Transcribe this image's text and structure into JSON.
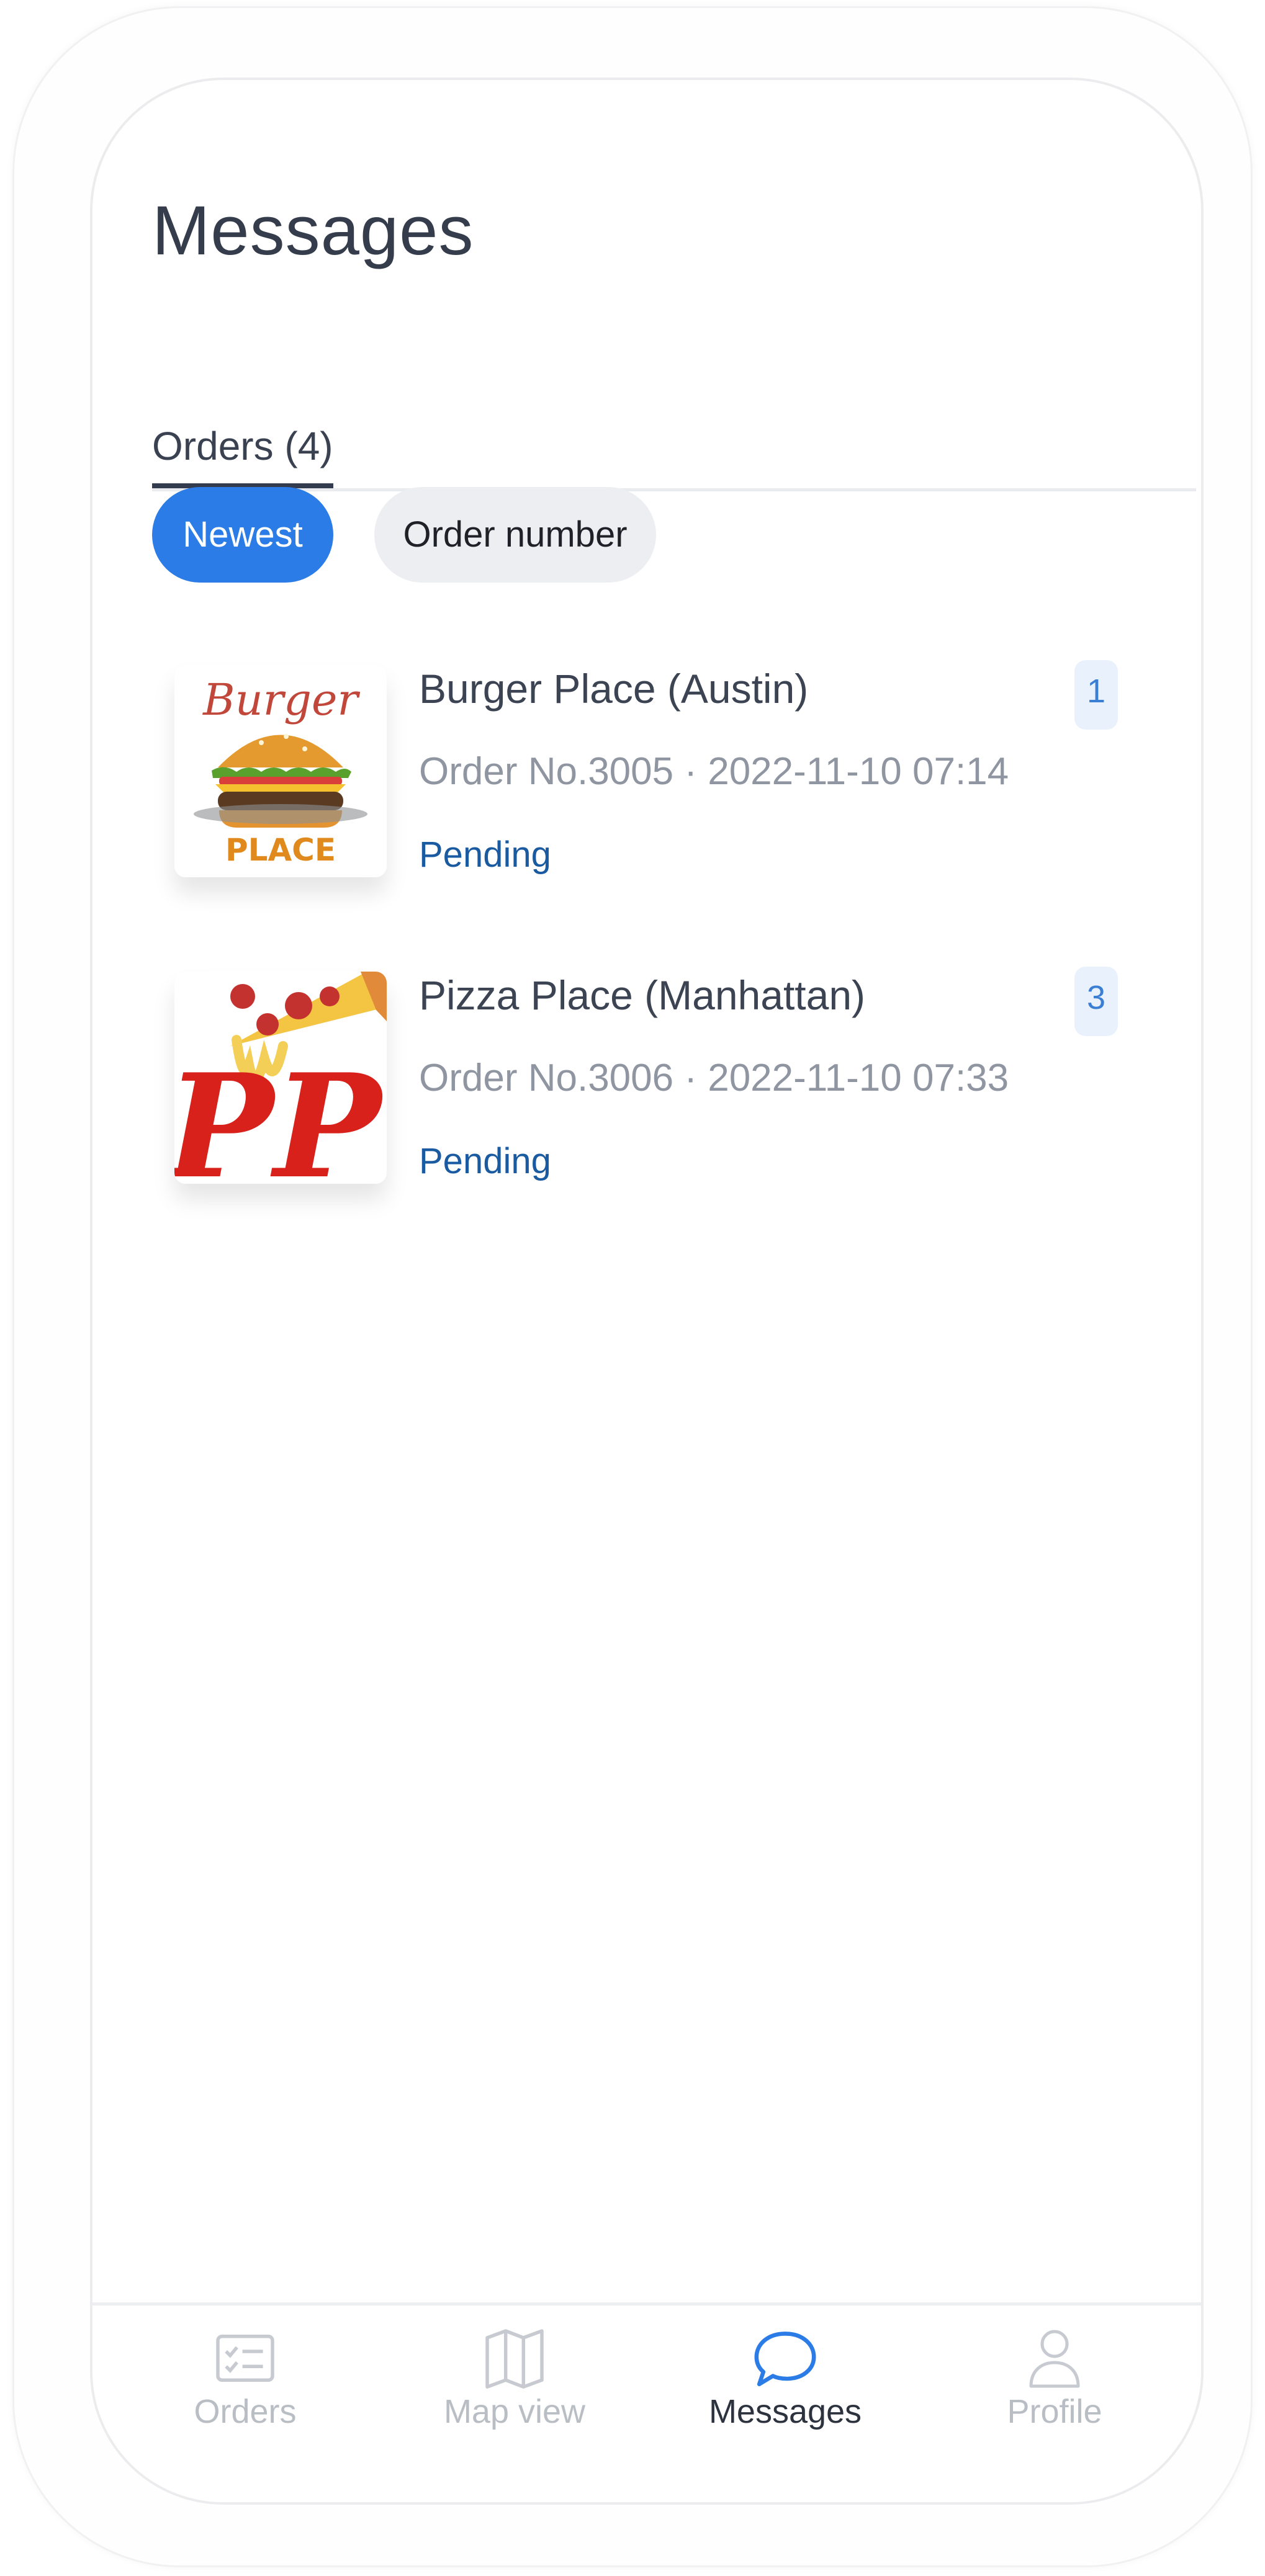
{
  "page": {
    "title": "Messages"
  },
  "tabs": [
    {
      "label": "Orders (4)"
    }
  ],
  "filters": {
    "newest": "Newest",
    "order_number": "Order number"
  },
  "orders": [
    {
      "restaurant": "Burger Place (Austin)",
      "meta": "Order No.3005 · 2022-11-10 07:14",
      "status": "Pending",
      "unread": "1",
      "logo_text_top": "Burger",
      "logo_text_bottom": "PLACE"
    },
    {
      "restaurant": "Pizza Place (Manhattan)",
      "meta": "Order No.3006 · 2022-11-10 07:33",
      "status": "Pending",
      "unread": "3",
      "logo_text": "PP"
    }
  ],
  "nav": [
    {
      "label": "Orders",
      "icon": "orders-list-icon"
    },
    {
      "label": "Map view",
      "icon": "map-icon"
    },
    {
      "label": "Messages",
      "icon": "chat-bubble-icon"
    },
    {
      "label": "Profile",
      "icon": "user-icon"
    }
  ],
  "colors": {
    "accent": "#2b7ce6",
    "status": "#1a5aa0",
    "badge_bg": "#e9f1fc"
  }
}
